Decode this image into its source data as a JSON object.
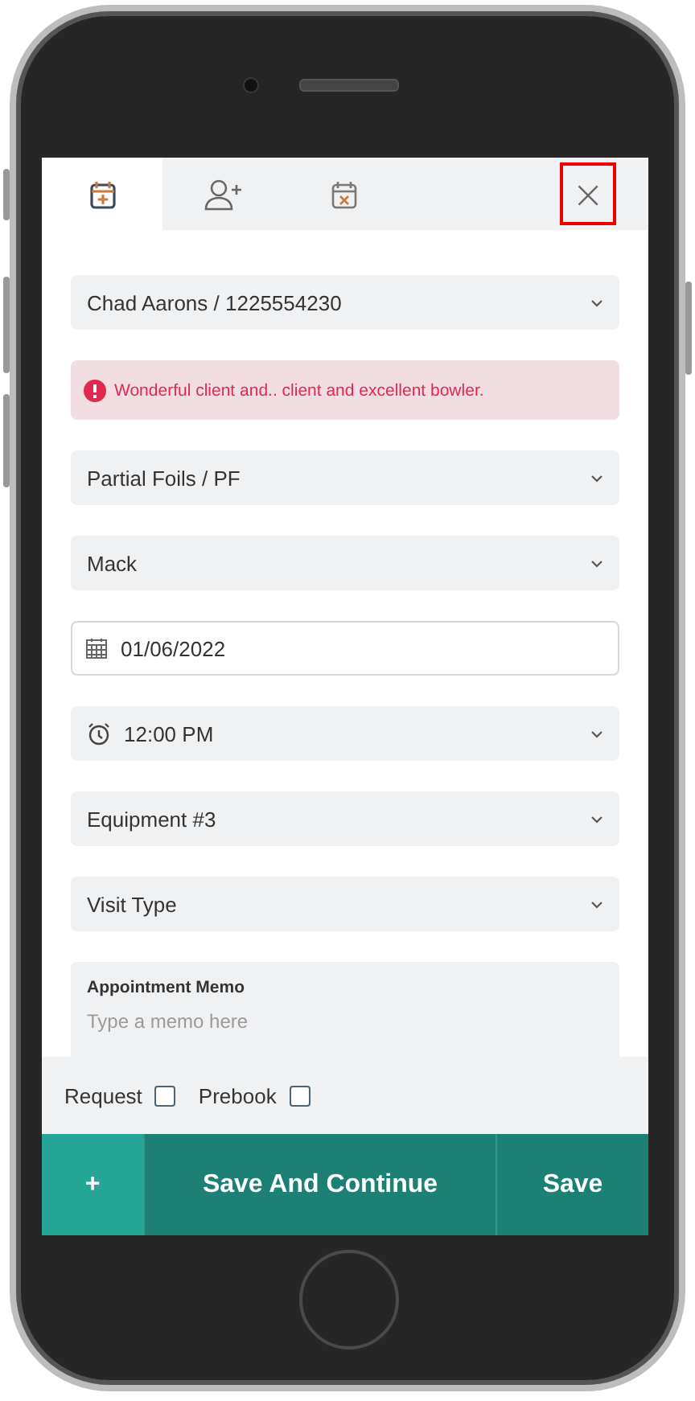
{
  "tabs": [
    {
      "kind": "calendar-add",
      "selected": true
    },
    {
      "kind": "person-add",
      "selected": false
    },
    {
      "kind": "calendar-remove",
      "selected": false
    }
  ],
  "close_button": {
    "label": "×"
  },
  "fields": [
    {
      "kind": "select",
      "value": "Chad Aarons / 1225554230"
    },
    {
      "kind": "alert",
      "value": "Wonderful client and.. client and excellent bowler."
    },
    {
      "kind": "select",
      "value": "Partial Foils / PF"
    },
    {
      "kind": "select",
      "value": "Mack"
    },
    {
      "kind": "date",
      "value": "01/06/2022"
    },
    {
      "kind": "time",
      "value": "12:00 PM"
    },
    {
      "kind": "select",
      "value": "Equipment #3"
    },
    {
      "kind": "select",
      "value": "Visit Type"
    },
    {
      "kind": "memo",
      "label": "Appointment Memo",
      "placeholder": "Type a memo here"
    }
  ],
  "checkboxes": [
    {
      "label": "Request",
      "checked": false
    },
    {
      "label": "Prebook",
      "checked": false
    }
  ],
  "buttons": [
    {
      "kind": "add",
      "label": "+"
    },
    {
      "kind": "primary",
      "label": "Save And Continue"
    },
    {
      "kind": "primary",
      "label": "Save"
    }
  ]
}
